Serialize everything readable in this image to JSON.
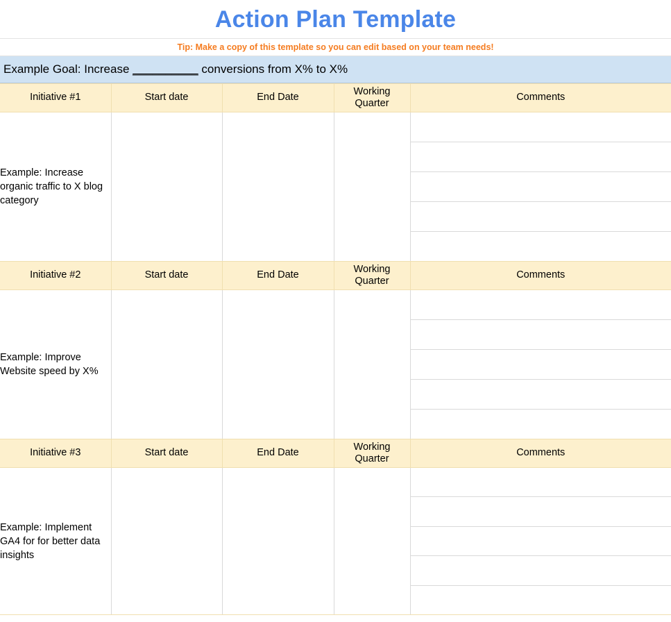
{
  "document": {
    "title": "Action Plan Template",
    "title_color": "#4a86e8",
    "tip": "Tip: Make a copy of this template so you can edit based on your team needs!",
    "tip_color": "#f57c20",
    "goal": {
      "prefix": "Example Goal: Increase ",
      "blank": "__________",
      "suffix": " conversions from X% to X%",
      "background_color": "#cfe2f3"
    }
  },
  "table": {
    "header_background_color": "#fdf0cd",
    "columns": {
      "start_date": "Start date",
      "end_date": "End Date",
      "working_quarter_line1": "Working",
      "working_quarter_line2": "Quarter",
      "comments": "Comments"
    },
    "blocks": [
      {
        "initiative_label": "Initiative #1",
        "start_date": "",
        "end_date": "",
        "working_quarter": "",
        "description": "Example: Increase organic traffic to X blog category",
        "comment_lines": [
          "",
          "",
          "",
          "",
          ""
        ]
      },
      {
        "initiative_label": "Initiative #2",
        "start_date": "",
        "end_date": "",
        "working_quarter": "",
        "description": "Example: Improve Website speed by X%",
        "comment_lines": [
          "",
          "",
          "",
          "",
          ""
        ]
      },
      {
        "initiative_label": "Initiative #3",
        "start_date": "",
        "end_date": "",
        "working_quarter": "",
        "description": "Example: Implement GA4 for for better data insights",
        "comment_lines": [
          "",
          "",
          "",
          "",
          ""
        ]
      }
    ]
  }
}
